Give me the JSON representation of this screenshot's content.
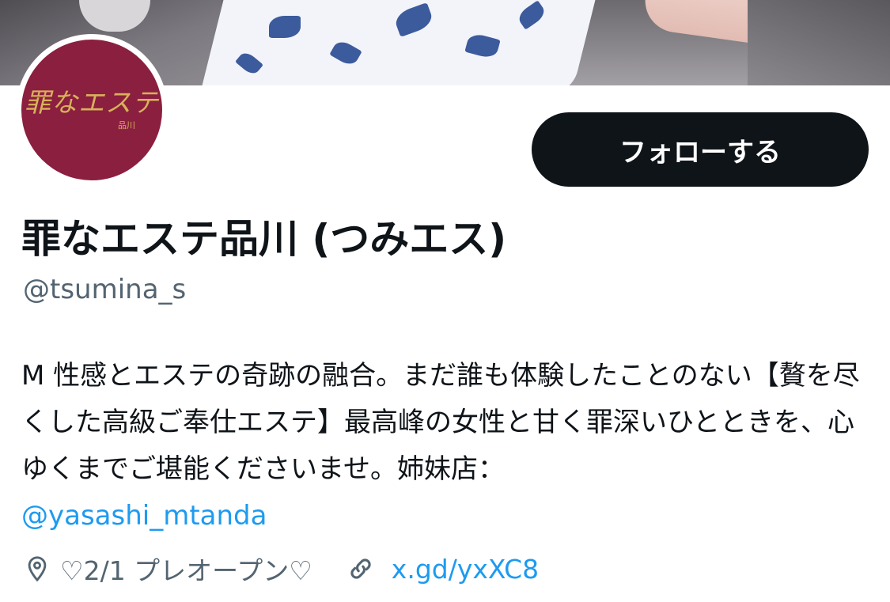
{
  "banner": {
    "image": "profile-banner-photo"
  },
  "avatar": {
    "logo_text": "罪なエステ",
    "logo_sub": "品川",
    "background_color": "#8b1f40"
  },
  "follow_button": {
    "label": "フォローする"
  },
  "profile": {
    "display_name": "罪なエステ品川 (つみエス)",
    "handle": "@tsumina_s",
    "bio_text": "M 性感とエステの奇跡の融合。まだ誰も体験したことのない【贅を尽くした高級ご奉仕エステ】最高峰の女性と甘く罪深いひとときを、心ゆくまでご堪能くださいませ。姉妹店：",
    "bio_mention": "@yasashi_mtanda",
    "location": "♡2/1 プレオープン♡",
    "location_icon": "location-pin-icon",
    "website": "x.gd/yxXC8",
    "website_icon": "link-icon"
  },
  "colors": {
    "accent": "#1d9bf0",
    "text": "#0f1419",
    "secondary": "#536471"
  }
}
